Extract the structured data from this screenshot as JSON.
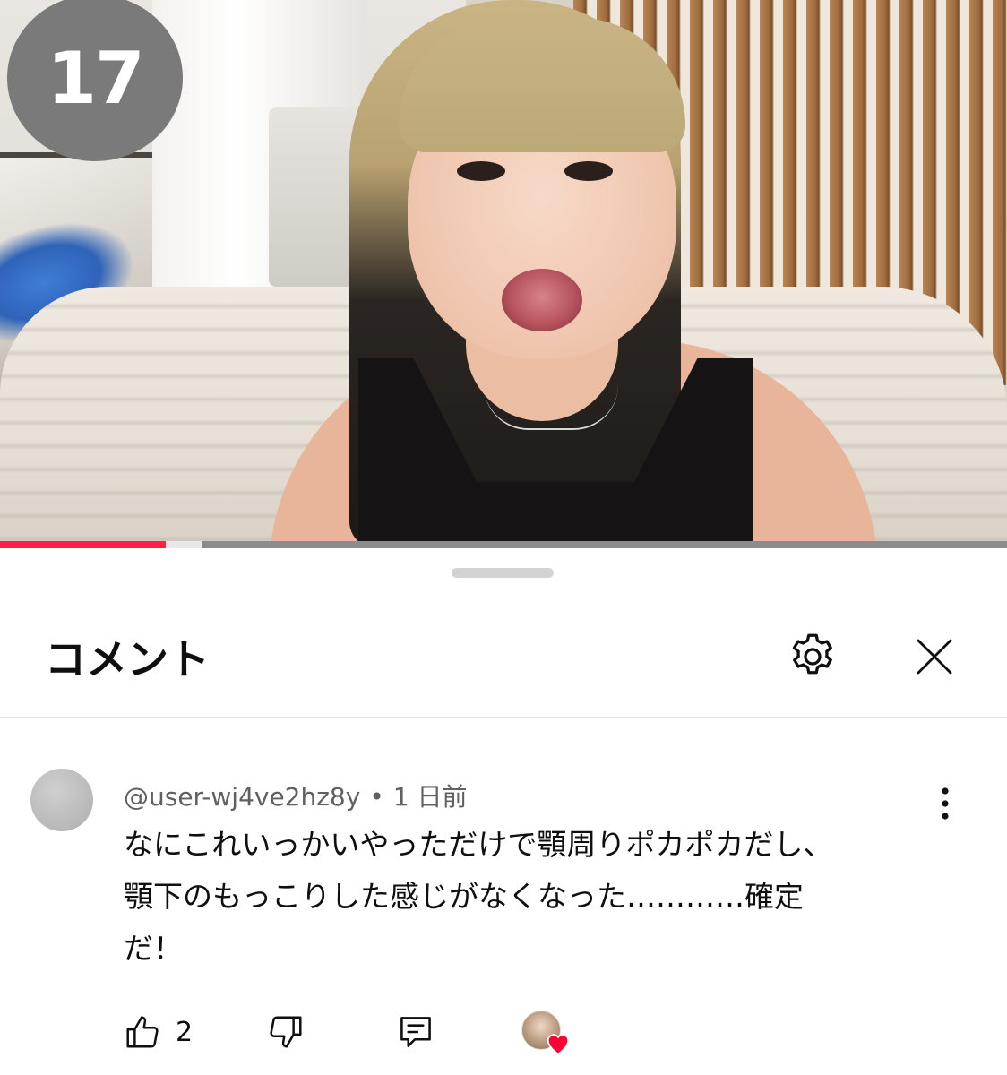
{
  "video": {
    "episode_badge": "17",
    "progress": 0.165,
    "buffered": 0.2
  },
  "comments_panel": {
    "title": "コメント",
    "settings_icon": "gear-icon",
    "close_icon": "close-icon"
  },
  "comment": {
    "author": "@user-wj4ve2hz8y",
    "separator": "•",
    "time": "1 日前",
    "text_lines": [
      "なにこれいっかいやっただけで顎周りポカポカだし、",
      "顎下のもっこりした感じがなくなった…………確定",
      "だ！"
    ],
    "like_count": "2",
    "icons": {
      "like": "thumbs-up-icon",
      "dislike": "thumbs-down-icon",
      "reply": "reply-icon",
      "more": "more-vertical-icon",
      "creator_heart": "heart-icon"
    }
  },
  "colors": {
    "accent_red": "#ff1f4b",
    "heart": "#ff0033",
    "text_primary": "#0f0f0f",
    "text_secondary": "#606060"
  }
}
